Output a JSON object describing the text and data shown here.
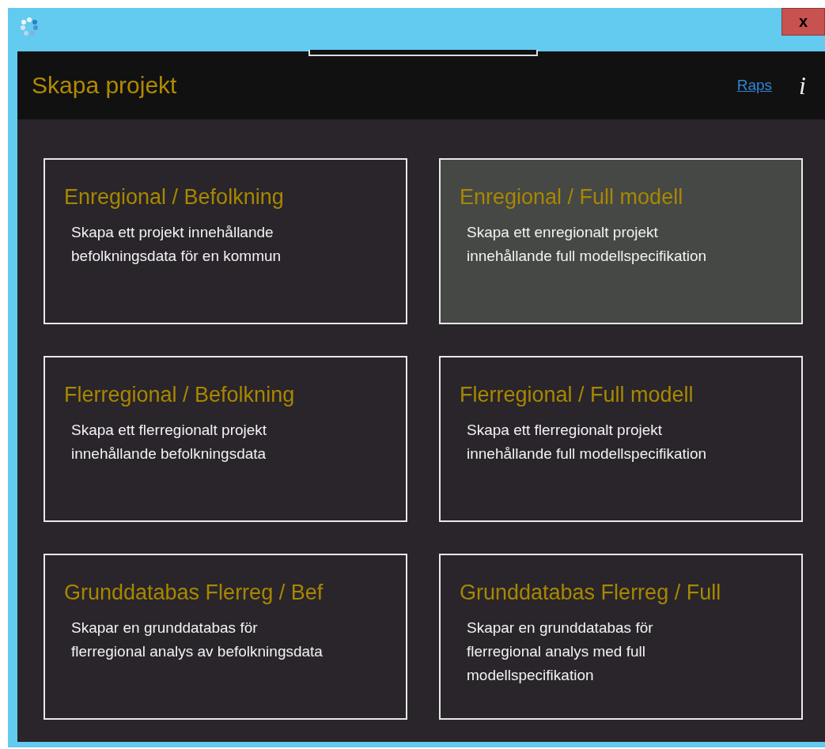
{
  "window": {
    "close_label": "x"
  },
  "header": {
    "title": "Skapa projekt",
    "link": "Raps",
    "info_label": "i"
  },
  "cards": [
    {
      "title": "Enregional / Befolkning",
      "lines": [
        "Skapa ett projekt innehållande",
        "befolkningsdata för en kommun"
      ],
      "selected": false
    },
    {
      "title": "Enregional / Full modell",
      "lines": [
        "Skapa ett enregionalt projekt",
        "innehållande full modellspecifikation"
      ],
      "selected": true
    },
    {
      "title": "Flerregional / Befolkning",
      "lines": [
        "Skapa ett flerregionalt projekt",
        "innehållande befolkningsdata"
      ],
      "selected": false
    },
    {
      "title": "Flerregional / Full modell",
      "lines": [
        "Skapa ett flerregionalt projekt",
        "innehållande full modellspecifikation"
      ],
      "selected": false
    },
    {
      "title": "Grunddatabas Flerreg / Bef",
      "lines": [
        "Skapar en grunddatabas för",
        "flerregional analys av befolkningsdata"
      ],
      "selected": false
    },
    {
      "title": "Grunddatabas Flerreg / Full",
      "lines": [
        "Skapar en grunddatabas för",
        "flerregional analys med full",
        "modellspecifikation"
      ],
      "selected": false
    }
  ]
}
